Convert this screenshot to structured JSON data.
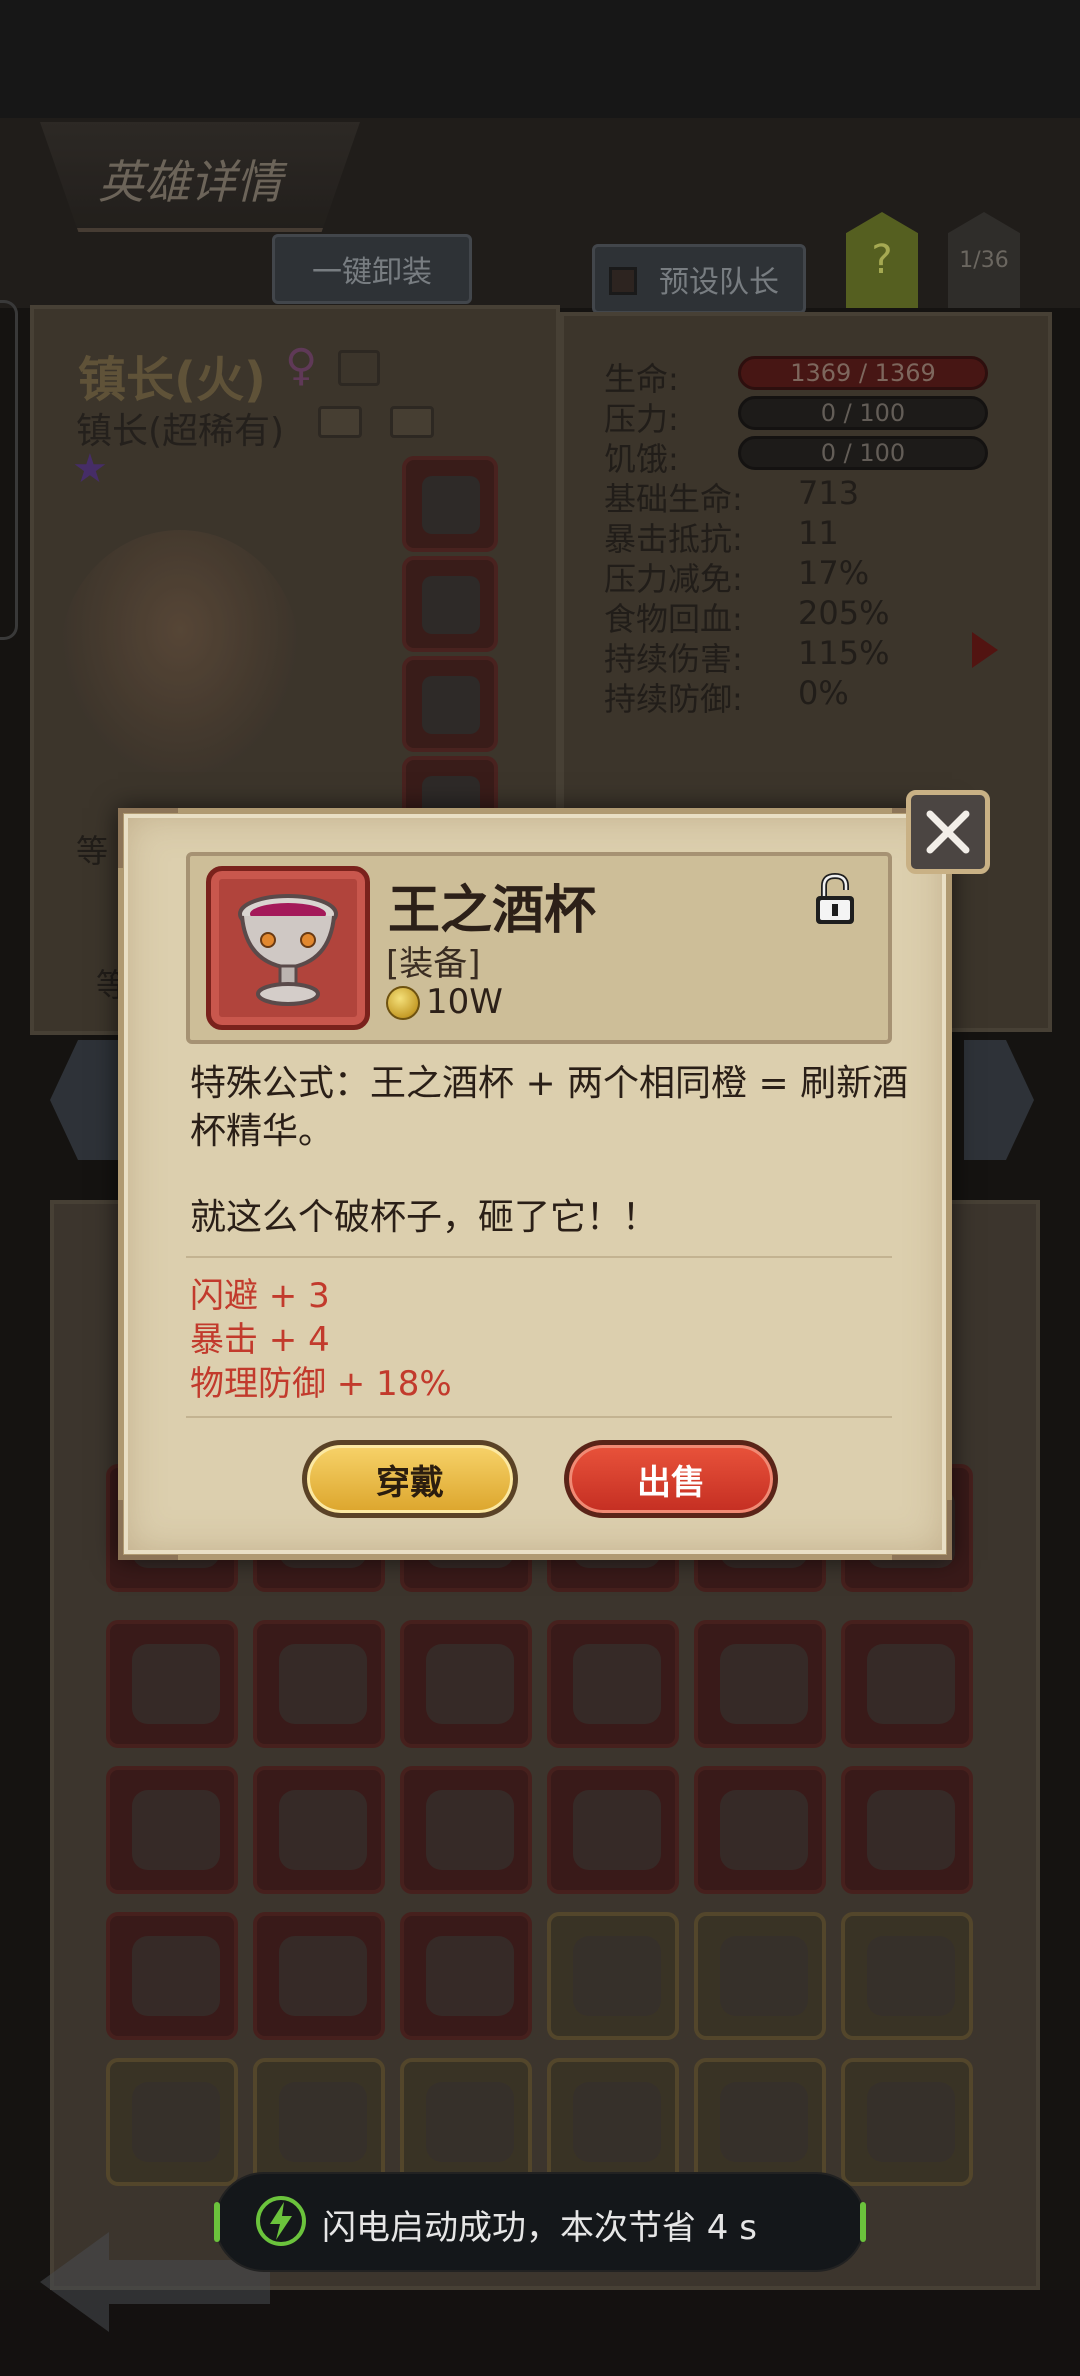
{
  "background": {
    "header_title": "英雄详情",
    "unequip_all_label": "一键卸装",
    "preset_leader_label": "预设队长",
    "help_label": "?",
    "page_indicator": "1/36",
    "hero": {
      "name": "镇长(火)",
      "gender_symbol": "♀",
      "class_label": "镇长(超稀有)",
      "star": "★"
    },
    "stats": {
      "life": {
        "label": "生命:",
        "value": "1369 / 1369"
      },
      "pressure": {
        "label": "压力:",
        "value": "0 / 100"
      },
      "hunger": {
        "label": "饥饿:",
        "value": "0 / 100"
      },
      "rows": [
        {
          "label": "基础生命:",
          "value": "713"
        },
        {
          "label": "暴击抵抗:",
          "value": "11"
        },
        {
          "label": "压力减免:",
          "value": "17%"
        },
        {
          "label": "食物回血:",
          "value": "205%"
        },
        {
          "label": "持续伤害:",
          "value": "115%"
        },
        {
          "label": "持续防御:",
          "value": "0%"
        }
      ]
    },
    "partial_left_labels": [
      "等",
      "等"
    ]
  },
  "dialog": {
    "item_name": "王之酒杯",
    "item_type": "[装备]",
    "price": "10W",
    "formula": "特殊公式：王之酒杯 + 两个相同橙 = 刷新酒杯精华。",
    "flavor_text": "就这么个破杯子，砸了它！！",
    "bonuses": [
      "闪避 + 3",
      "暴击 + 4",
      "物理防御 + 18%"
    ],
    "wear_button": "穿戴",
    "sell_button": "出售"
  },
  "toast": {
    "message": "闪电启动成功，本次节省 4 s"
  },
  "colors": {
    "bonus_red": "#c23a2c",
    "wear_gold": "#f0c24a",
    "sell_red": "#d83c2c",
    "toast_green": "#6bc33c"
  }
}
